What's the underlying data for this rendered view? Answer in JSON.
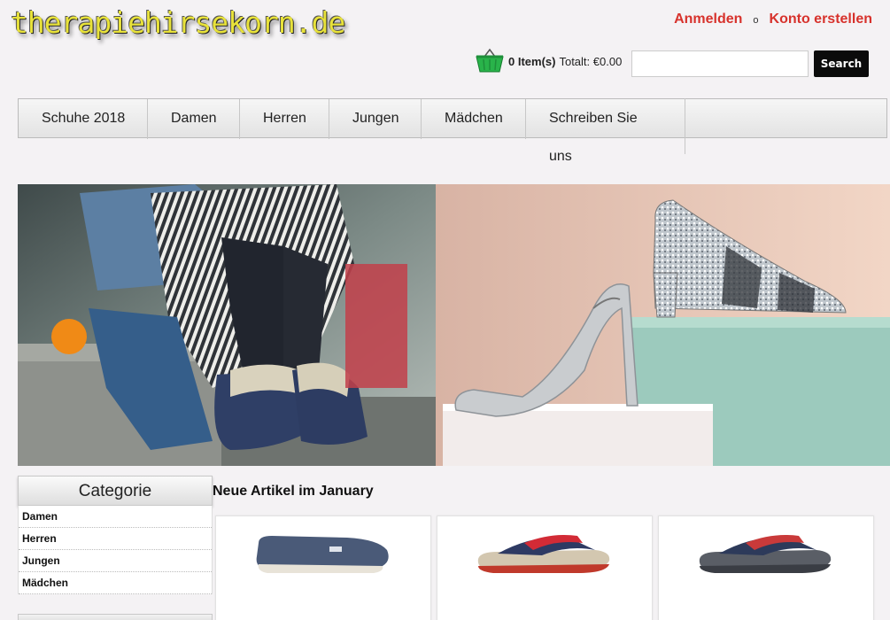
{
  "site": {
    "logo": "therapiehirsekorn.de"
  },
  "account": {
    "login": "Anmelden",
    "separator": "o",
    "register": "Konto erstellen"
  },
  "cart": {
    "icon": "basket-icon",
    "items": "0 Item(s)",
    "total_label": "Totalt:",
    "total_value": "€0.00"
  },
  "search": {
    "value": "",
    "placeholder": "",
    "button": "Search"
  },
  "nav": {
    "items": [
      {
        "label": "Schuhe 2018"
      },
      {
        "label": "Damen"
      },
      {
        "label": "Herren"
      },
      {
        "label": "Jungen"
      },
      {
        "label": "Mädchen"
      },
      {
        "label": "Schreiben Sie",
        "label_continued": "uns"
      }
    ]
  },
  "sidebar": {
    "title": "Categorie",
    "items": [
      {
        "label": "Damen"
      },
      {
        "label": "Herren"
      },
      {
        "label": "Jungen"
      },
      {
        "label": "Mädchen"
      }
    ]
  },
  "main": {
    "section_title": "Neue Artikel im January",
    "products": [
      {},
      {},
      {}
    ]
  },
  "colors": {
    "link_red": "#d7322c",
    "logo_yellow": "#e8e23a",
    "search_button": "#0b0b0b"
  }
}
